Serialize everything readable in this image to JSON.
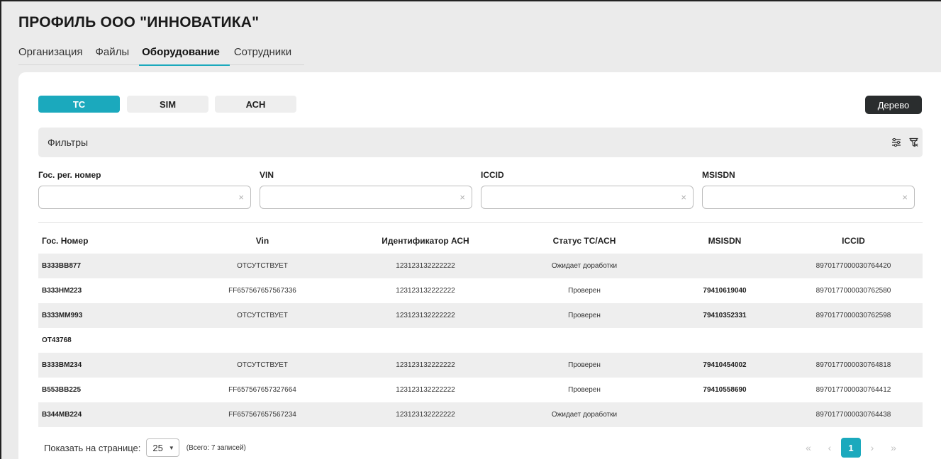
{
  "page": {
    "title": "ПРОФИЛЬ ООО \"ИННОВАТИКА\""
  },
  "tabs": [
    {
      "label": "Организация",
      "active": false
    },
    {
      "label": "Файлы",
      "active": false
    },
    {
      "label": "Оборудование",
      "active": true
    },
    {
      "label": "Сотрудники",
      "active": false
    }
  ],
  "segments": [
    {
      "label": "ТС",
      "active": true
    },
    {
      "label": "SIM",
      "active": false
    },
    {
      "label": "АСН",
      "active": false
    }
  ],
  "tree_button": {
    "label": "Дерево"
  },
  "filters": {
    "title": "Фильтры",
    "icons": [
      "sliders-icon",
      "filter-clear-icon"
    ],
    "fields": [
      {
        "label": "Гос. рег. номер",
        "value": "",
        "clear": "×"
      },
      {
        "label": "VIN",
        "value": "",
        "clear": "×"
      },
      {
        "label": "ICCID",
        "value": "",
        "clear": "×"
      },
      {
        "label": "MSISDN",
        "value": "",
        "clear": "×"
      }
    ]
  },
  "table": {
    "columns": [
      "Гос. Номер",
      "Vin",
      "Идентификатор АСН",
      "Статус ТС/АСН",
      "MSISDN",
      "ICCID"
    ],
    "rows": [
      [
        "В333ВВ877",
        "ОТСУТСТВУЕТ",
        "123123132222222",
        "Ожидает доработки",
        "",
        "8970177000030764420"
      ],
      [
        "В333НМ223",
        "FF657567657567336",
        "123123132222222",
        "Проверен",
        "79410619040",
        "8970177000030762580"
      ],
      [
        "В333ММ993",
        "ОТСУТСТВУЕТ",
        "123123132222222",
        "Проверен",
        "79410352331",
        "8970177000030762598"
      ],
      [
        "ОТ43768",
        "",
        "",
        "",
        "",
        ""
      ],
      [
        "В333ВМ234",
        "ОТСУТСТВУЕТ",
        "123123132222222",
        "Проверен",
        "79410454002",
        "8970177000030764818"
      ],
      [
        "В553ВВ225",
        "FF657567657327664",
        "123123132222222",
        "Проверен",
        "79410558690",
        "8970177000030764412"
      ],
      [
        "В344МВ224",
        "FF657567657567234",
        "123123132222222",
        "Ожидает доработки",
        "",
        "8970177000030764438"
      ]
    ]
  },
  "footer": {
    "per_page_label": "Показать на странице:",
    "per_page_value": "25",
    "total": "(Всего: 7 записей)"
  },
  "pagination": {
    "first": "«",
    "prev": "‹",
    "current": "1",
    "next": "›",
    "last": "»"
  },
  "colors": {
    "accent": "#1ba9bd",
    "dark_button": "#2a2d2e",
    "row_stripe": "#eeeeee"
  }
}
